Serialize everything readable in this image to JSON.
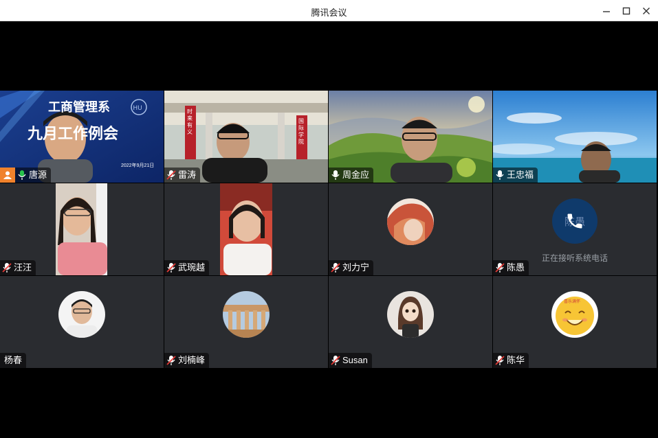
{
  "window": {
    "title": "腾讯会议"
  },
  "participants": [
    {
      "name": "唐源"
    },
    {
      "name": "雷涛"
    },
    {
      "name": "周金应"
    },
    {
      "name": "王忠福"
    },
    {
      "name": "汪汪"
    },
    {
      "name": "武琬越"
    },
    {
      "name": "刘力宁"
    },
    {
      "name": "陈愚",
      "avatar_text": "陈愚",
      "status": "正在接听系统电话"
    },
    {
      "name": "杨春"
    },
    {
      "name": "刘楠峰"
    },
    {
      "name": "Susan"
    },
    {
      "name": "陈华"
    }
  ],
  "slide": {
    "line1": "工商管理系",
    "line2": "九月工作例会",
    "date": "2022年9月21日"
  },
  "gate_banner": [
    "时来有义",
    "国际学院"
  ],
  "avatar_badge": "喜乐满怀",
  "colors": {
    "tile_bg": "#2a2c30",
    "active_border": "#27c24c",
    "phone_bg": "#0f3a6b",
    "user_badge": "#f0822c"
  }
}
